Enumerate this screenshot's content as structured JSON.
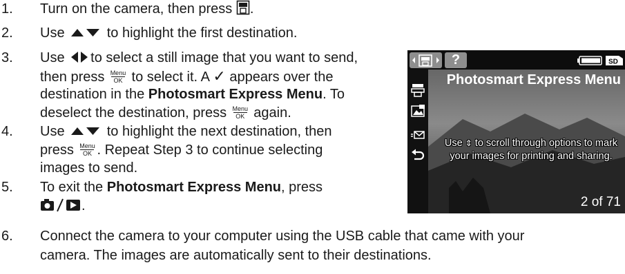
{
  "steps": [
    {
      "num": "1.",
      "line1": "Turn on the camera, then press",
      "end": "."
    },
    {
      "num": "2.",
      "use": "Use",
      "line1": "to highlight the first destination."
    },
    {
      "num": "3.",
      "use": "Use",
      "line1": "to select a still image that you want to send,",
      "line2a": "then press",
      "line2b": "to select it. A",
      "line2c": "appears over the",
      "line3a": "destination in the",
      "line3b": "Photosmart Express Menu",
      "line3c": ". To",
      "line4a": "deselect the destination, press",
      "line4b": "again."
    },
    {
      "num": "4.",
      "use": "Use",
      "line1": "to highlight the next destination, then",
      "line2a": "press",
      "line2b": ". Repeat Step 3 to continue selecting",
      "line3": "images to send."
    },
    {
      "num": "5.",
      "line1a": "To exit the",
      "line1b": "Photosmart Express Menu",
      "line1c": ", press",
      "end": "."
    },
    {
      "num": "6.",
      "line1": "Connect the camera to your computer using the USB cable that came with your",
      "line2": "camera. The images are automatically sent to their destinations."
    }
  ],
  "menu_ok": {
    "top": "Menu",
    "bottom": "OK"
  },
  "checkmark": "✓",
  "camera_screen": {
    "help_tab": "?",
    "title": "Photosmart Express Menu",
    "message_a": "Use",
    "message_b": "to scroll through options to mark your images for printing and sharing.",
    "counter": "2 of 71",
    "sidebar_icons": [
      "print-icon",
      "print-select-icon",
      "share-icon",
      "back-icon"
    ]
  },
  "colors": {
    "text": "#1a1a1a",
    "screen_bg": "#2c2c2c",
    "screen_text": "#ffffff",
    "tab_active": "#8e8e8e"
  }
}
